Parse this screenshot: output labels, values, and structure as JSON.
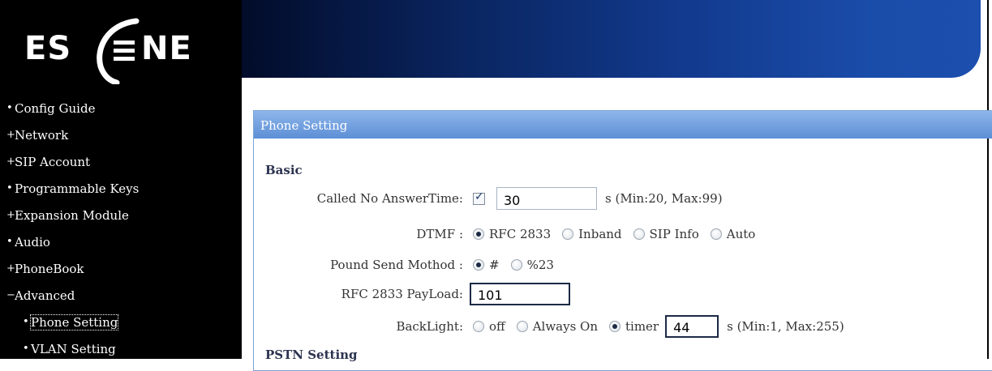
{
  "logo": {
    "text": "ES",
    "text2": "NE"
  },
  "sidebar": {
    "items": [
      {
        "label": "Config Guide",
        "marker": "•"
      },
      {
        "label": "Network",
        "marker": "+"
      },
      {
        "label": "SIP Account",
        "marker": "+"
      },
      {
        "label": "Programmable Keys",
        "marker": "•"
      },
      {
        "label": "Expansion Module",
        "marker": "+"
      },
      {
        "label": "Audio",
        "marker": "•"
      },
      {
        "label": "PhoneBook",
        "marker": "+"
      },
      {
        "label": "Advanced",
        "marker": "−"
      }
    ],
    "subitems": [
      {
        "label": "Phone Setting",
        "marker": "•"
      },
      {
        "label": "VLAN Setting",
        "marker": "•"
      }
    ]
  },
  "panel": {
    "title": "Phone Setting",
    "basic": {
      "heading": "Basic",
      "called_no_answer": {
        "label": "Called No AnswerTime:",
        "value": "30",
        "hint": "s  (Min:20, Max:99)",
        "checked": true
      },
      "dtmf": {
        "label": "DTMF :",
        "options": [
          "RFC 2833",
          "Inband",
          "SIP Info",
          "Auto"
        ],
        "selected": "RFC 2833"
      },
      "pound": {
        "label": "Pound Send Mothod :",
        "options": [
          "#",
          "%23"
        ],
        "selected": "#"
      },
      "payload": {
        "label": "RFC 2833 PayLoad:",
        "value": "101"
      },
      "backlight": {
        "label": "BackLight:",
        "options": [
          "off",
          "Always On",
          "timer"
        ],
        "selected": "timer",
        "value": "44",
        "hint": "s (Min:1, Max:255)"
      }
    },
    "pstn": {
      "heading": "PSTN Setting"
    }
  },
  "colors": {
    "header": "#123a8e",
    "panel_title": "#6f9ee0",
    "sidebar": "#000000"
  }
}
